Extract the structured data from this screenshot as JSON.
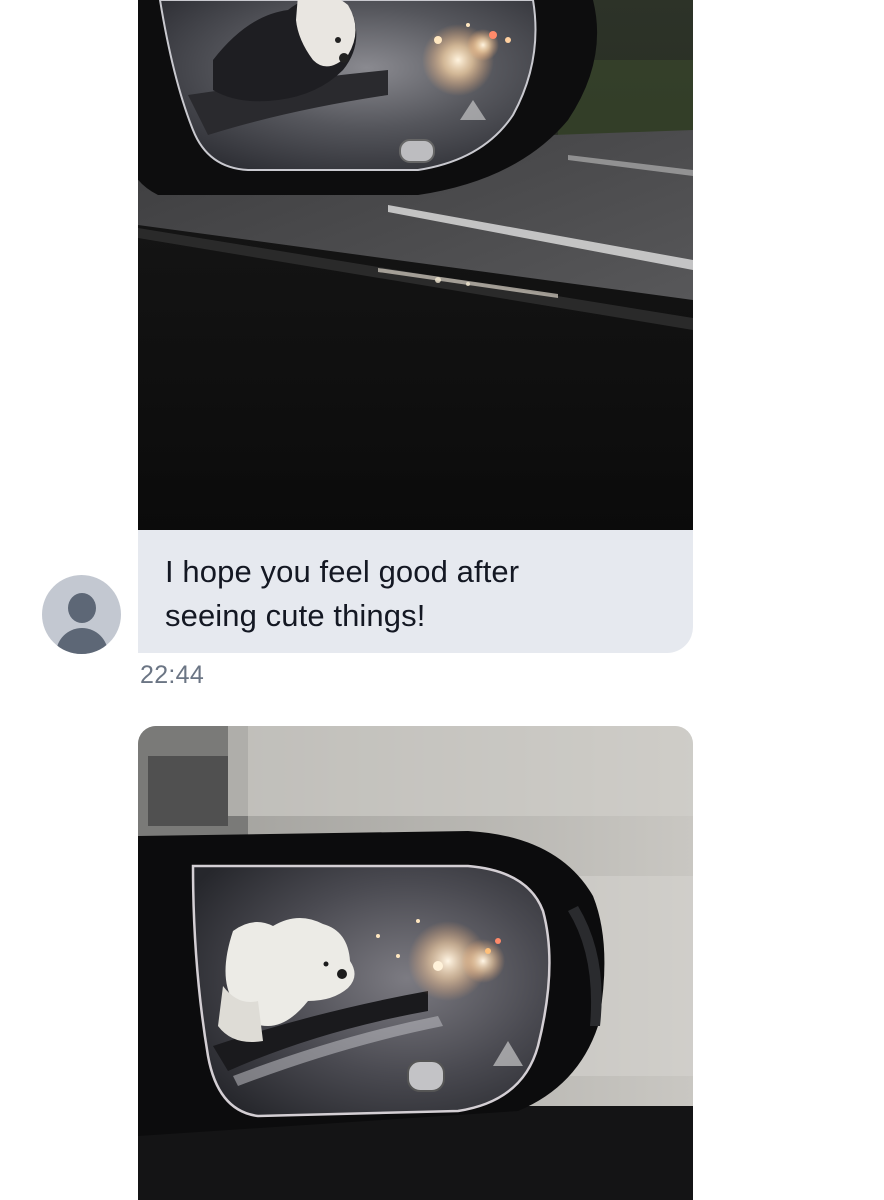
{
  "messages": [
    {
      "type": "photo",
      "icon": "photo-mirror-dog-night"
    },
    {
      "type": "text",
      "text_line1": "I hope you feel good after",
      "text_line2": "seeing cute things!",
      "time": "22:44",
      "avatar_icon": "default-user-icon"
    },
    {
      "type": "photo",
      "icon": "photo-mirror-dog-closeup"
    }
  ],
  "colors": {
    "bubble": "#e6e9ef",
    "text": "#141823",
    "timestamp": "#6b7584",
    "avatar_bg": "#c3c8d1",
    "avatar_fg": "#5d6776"
  }
}
